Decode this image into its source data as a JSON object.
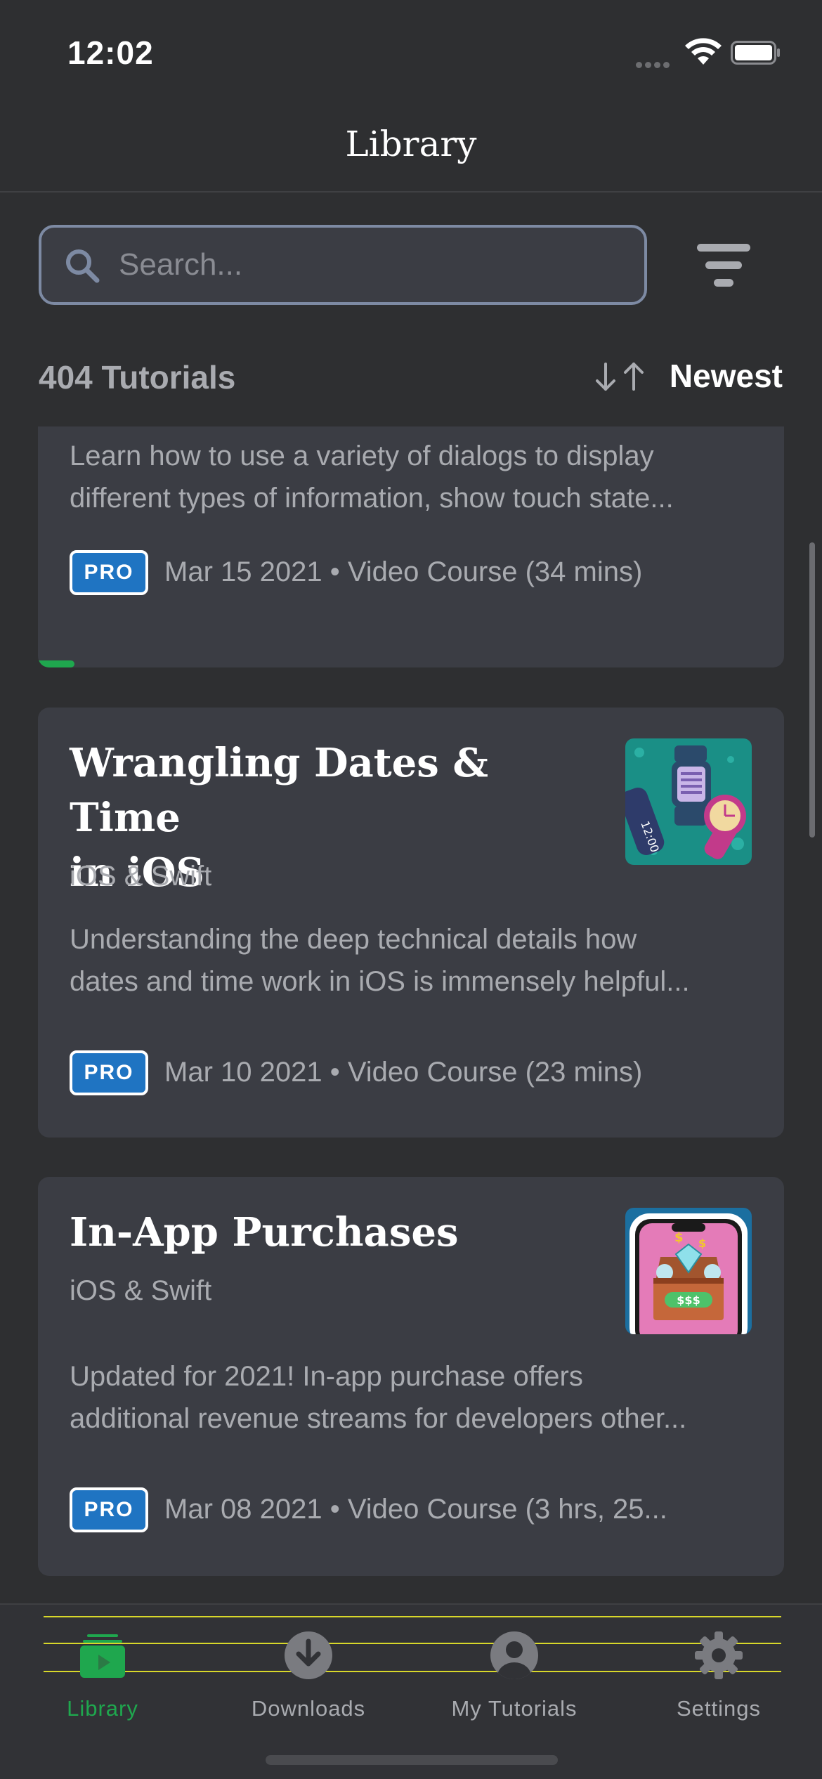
{
  "status_bar": {
    "time": "12:02"
  },
  "nav": {
    "title": "Library"
  },
  "search": {
    "placeholder": "Search..."
  },
  "summary": {
    "count_label": "404 Tutorials",
    "sort_label": "Newest"
  },
  "cards": [
    {
      "title": "",
      "subtitle": "",
      "description_line1": "Learn how to use a variety of dialogs to display",
      "description_line2": "different types of information, show touch state...",
      "badge": "PRO",
      "meta": "Mar 15 2021 • Video Course (34 mins)",
      "progress": 0.05
    },
    {
      "title_line1": "Wrangling Dates & Time",
      "title_line2": "in iOS",
      "subtitle": "iOS & Swift",
      "description_line1": "Understanding the deep technical details how",
      "description_line2": "dates and time work in iOS is immensely helpful...",
      "badge": "PRO",
      "meta": "Mar 10 2021 • Video Course (23 mins)",
      "thumbnail": "watches-artwork"
    },
    {
      "title_line1": "In-App Purchases",
      "subtitle": "iOS & Swift",
      "description_line1": "Updated for 2021! In-app purchase offers",
      "description_line2": "additional revenue streams for developers other...",
      "badge": "PRO",
      "meta": "Mar 08 2021 • Video Course (3 hrs, 25...",
      "thumbnail": "treasure-chest-artwork"
    }
  ],
  "tabs": [
    {
      "label": "Library",
      "icon": "library-icon",
      "active": true
    },
    {
      "label": "Downloads",
      "icon": "download-icon",
      "active": false
    },
    {
      "label": "My Tutorials",
      "icon": "person-icon",
      "active": false
    },
    {
      "label": "Settings",
      "icon": "gear-icon",
      "active": false
    }
  ],
  "colors": {
    "accent": "#1fa74e",
    "pro_badge": "#1f74c2",
    "background": "#2e2f31",
    "card": "#3b3d44"
  }
}
